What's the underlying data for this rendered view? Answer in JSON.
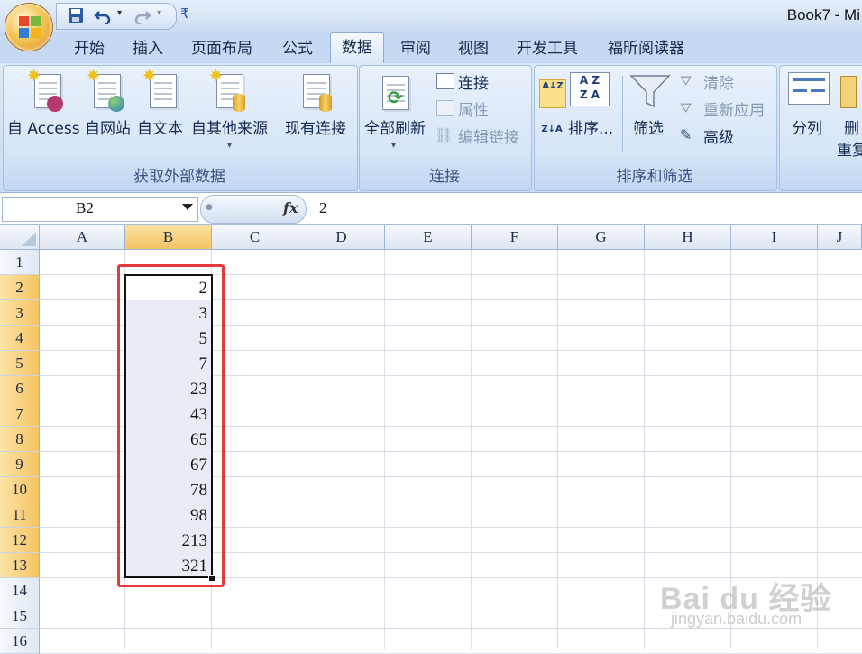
{
  "window": {
    "title": "Book7 - Mi"
  },
  "quick_access": {
    "save_icon": "save-icon",
    "undo_icon": "undo-icon",
    "redo_icon": "redo-icon",
    "customize_symbol": "₹"
  },
  "tabs": [
    {
      "label": "开始",
      "active": false
    },
    {
      "label": "插入",
      "active": false
    },
    {
      "label": "页面布局",
      "active": false
    },
    {
      "label": "公式",
      "active": false
    },
    {
      "label": "数据",
      "active": true
    },
    {
      "label": "审阅",
      "active": false
    },
    {
      "label": "视图",
      "active": false
    },
    {
      "label": "开发工具",
      "active": false
    },
    {
      "label": "福昕阅读器",
      "active": false
    }
  ],
  "ribbon": {
    "external_data": {
      "group_label": "获取外部数据",
      "buttons": [
        "自 Access",
        "自网站",
        "自文本",
        "自其他来源"
      ],
      "existing_connections": "现有连接"
    },
    "connections": {
      "group_label": "连接",
      "refresh_all": "全部刷新",
      "connections": "连接",
      "properties": "属性",
      "edit_links": "编辑链接"
    },
    "sort_filter": {
      "group_label": "排序和筛选",
      "sort": "排序...",
      "filter": "筛选",
      "clear": "清除",
      "reapply": "重新应用",
      "advanced": "高级",
      "sort_az_glyph": "A↓Z",
      "sort_za_glyph": "Z↓A"
    },
    "data_tools": {
      "text_to_columns": "分列",
      "remove_dup_line1": "删",
      "remove_dup_line2": "重复"
    }
  },
  "formula_bar": {
    "name_box": "B2",
    "fx_label": "fx",
    "value": "2"
  },
  "columns": [
    "A",
    "B",
    "C",
    "D",
    "E",
    "F",
    "G",
    "H",
    "I",
    "J"
  ],
  "rows": [
    "1",
    "2",
    "3",
    "4",
    "5",
    "6",
    "7",
    "8",
    "9",
    "10",
    "11",
    "12",
    "13",
    "14",
    "15",
    "16"
  ],
  "selected_column": "B",
  "cells_B": [
    "2",
    "3",
    "5",
    "7",
    "23",
    "43",
    "65",
    "67",
    "78",
    "98",
    "213",
    "321"
  ],
  "watermark": {
    "brand": "Bai du 经验",
    "site": "jingyan.baidu.com"
  },
  "colors": {
    "highlight": "#e23b3b",
    "selection_header": "#f5c462",
    "ribbon": "#d6e5f7"
  }
}
